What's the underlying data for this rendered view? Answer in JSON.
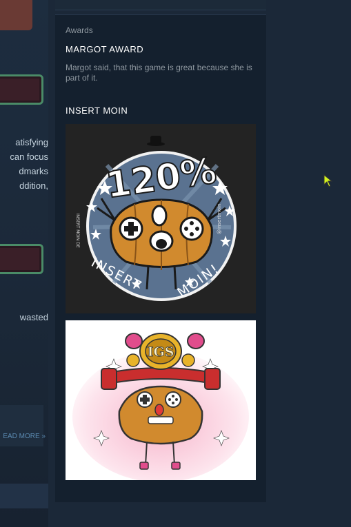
{
  "left": {
    "snippet1": [
      "atisfying",
      "can focus",
      "dmarks",
      "ddition,"
    ],
    "snippet2": [
      "wasted"
    ],
    "read_more": "EAD MORE »"
  },
  "sidebar": {
    "section_label": "Awards",
    "awards": [
      {
        "title": "MARGOT AWARD",
        "description": "Margot said, that this game is great because she is part of it."
      },
      {
        "title": "INSERT MOIN",
        "images": [
          {
            "text_main": "120%",
            "text_bottom_left": "INSERT",
            "text_bottom_right": "MOIN!",
            "side_left": "INSERT MOIN DE",
            "side_right": "@insertmoin"
          },
          {
            "belt_text": "IGS"
          }
        ]
      }
    ]
  },
  "colors": {
    "background": "#1b2838",
    "panel": "#14202e",
    "accent_green": "#4a8b67",
    "cursor": "#d2f21e"
  }
}
